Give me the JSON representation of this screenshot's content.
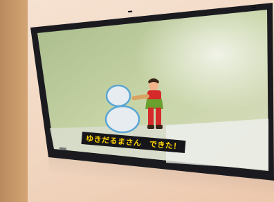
{
  "photo": {
    "subject": "wall-mounted-tv-showing-animation",
    "subtitle_text": "ゆきだるまさん　できた！",
    "hud_line1": "",
    "hud_line2": "",
    "hud_right": ""
  },
  "colors": {
    "wall": "#f1d6c0",
    "tv_frame": "#1b1b1f",
    "screen_bg": "#b9c99a",
    "subtitle_text": "#ffd400",
    "subtitle_bg": "#15151a"
  }
}
